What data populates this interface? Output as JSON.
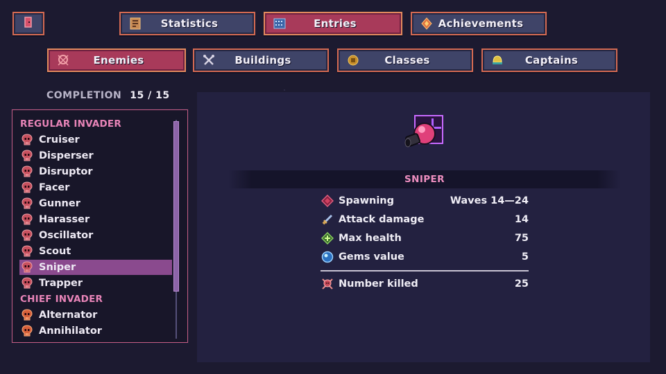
{
  "top_tabs": {
    "statistics": "Statistics",
    "entries": "Entries",
    "achievements": "Achievements"
  },
  "sub_tabs": {
    "enemies": "Enemies",
    "buildings": "Buildings",
    "classes": "Classes",
    "captains": "Captains"
  },
  "completion": {
    "label": "COMPLETION",
    "value": "15 / 15"
  },
  "list": {
    "group_regular": "REGULAR INVADER",
    "regular": [
      "Cruiser",
      "Disperser",
      "Disruptor",
      "Facer",
      "Gunner",
      "Harasser",
      "Oscillator",
      "Scout",
      "Sniper",
      "Trapper"
    ],
    "group_chief": "CHIEF INVADER",
    "chief": [
      "Alternator",
      "Annihilator"
    ],
    "selected": "Sniper"
  },
  "detail": {
    "name": "SNIPER",
    "stats": [
      {
        "label": "Spawning",
        "value": "Waves 14—24",
        "icon": "spawn-diamond-icon"
      },
      {
        "label": "Attack damage",
        "value": "14",
        "icon": "sword-icon"
      },
      {
        "label": "Max health",
        "value": "75",
        "icon": "health-diamond-icon"
      },
      {
        "label": "Gems value",
        "value": "5",
        "icon": "gem-orb-icon"
      }
    ],
    "killed": {
      "label": "Number killed",
      "value": "25",
      "icon": "skull-icon"
    }
  },
  "colors": {
    "accent_pink": "#e884b8",
    "active_tab": "#a83a5a",
    "tab_border": "#d46a52",
    "selected_row": "#8a4a8e"
  }
}
